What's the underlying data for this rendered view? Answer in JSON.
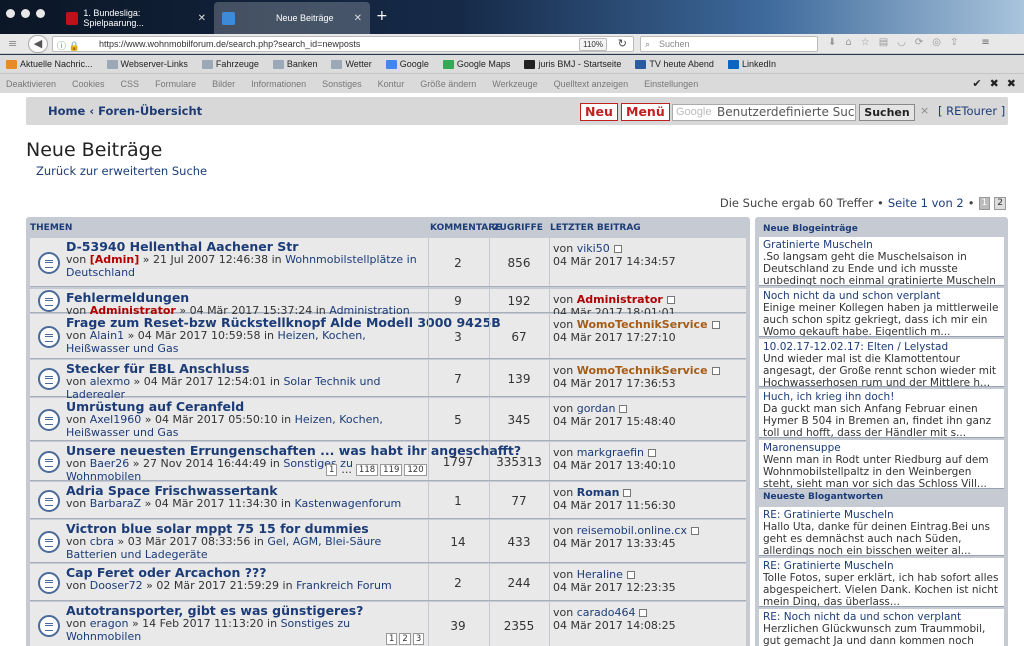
{
  "browser": {
    "tabs": [
      {
        "label": "1. Bundesliga: Spielpaarung...",
        "favicon_color": "#c0101a"
      },
      {
        "label": "Neue Beiträge",
        "favicon_color": "#3c8ad8"
      }
    ],
    "url": "https://www.wohnmobilforum.de/search.php?search_id=newposts",
    "zoom": "110%",
    "search_placeholder": "Suchen",
    "bookmarks": [
      "Aktuelle Nachric...",
      "Webserver-Links",
      "Fahrzeuge",
      "Banken",
      "Wetter",
      "Google",
      "Google Maps",
      "juris BMJ - Startseite",
      "TV heute Abend",
      "LinkedIn"
    ],
    "toolbar2": [
      "Deaktivieren",
      "Cookies",
      "CSS",
      "Formulare",
      "Bilder",
      "Informationen",
      "Sonstiges",
      "Kontur",
      "Größe ändern",
      "Werkzeuge",
      "Quelltext anzeigen",
      "Einstellungen"
    ]
  },
  "topbar": {
    "home": "Home",
    "sep": "‹",
    "forums": "Foren-Übersicht",
    "neu": "Neu",
    "menu": "Menü",
    "search_placeholder": "Benutzerdefinierte Such",
    "google": "Google",
    "search_btn": "Suchen",
    "clear": "×",
    "retour": "[ RETourer ]"
  },
  "page": {
    "title": "Neue Beiträge",
    "back": "Zurück zur erweiterten Suche"
  },
  "pagination": {
    "text": "Die Suche ergab 60 Treffer •",
    "page": "Seite 1 von 2",
    "sep": "•",
    "p1": "1",
    "p2": "2"
  },
  "forum": {
    "headers": {
      "topics": "THEMEN",
      "comments": "KOMMENTARE",
      "views": "ZUGRIFFE",
      "last": "LETZTER BEITRAG"
    },
    "rows": [
      {
        "title": "D-53940 Hellenthal Aachener Str",
        "von": "von",
        "author": "[Admin]",
        "admin": true,
        "date": "» 21 Jul 2007 12:46:38 in",
        "forum": "Wohnmobilstellplätze in Deutschland",
        "replies": "2",
        "views": "856",
        "last_user": "viki50",
        "last_date": "04 Mär 2017 14:34:57",
        "pages": []
      },
      {
        "title": "Fehlermeldungen",
        "von": "von",
        "author": "Administrator",
        "admin": true,
        "date": "» 04 Mär 2017 15:37:24 in",
        "forum": "Administration",
        "replies": "9",
        "views": "192",
        "last_user": "Administrator",
        "last_date": "04 Mär 2017 18:01:01",
        "pages": []
      },
      {
        "title": "Frage zum Reset-bzw Rückstellknopf Alde Modell 3000 9425B",
        "von": "von",
        "author": "Alain1",
        "admin": false,
        "date": "» 04 Mär 2017 10:59:58 in",
        "forum": "Heizen, Kochen, Heißwasser und Gas",
        "replies": "3",
        "views": "67",
        "last_user": "WomoTechnikService",
        "last_date": "04 Mär 2017 17:27:10",
        "pages": []
      },
      {
        "title": "Stecker für EBL Anschluss",
        "von": "von",
        "author": "alexmo",
        "admin": false,
        "date": "» 04 Mär 2017 12:54:01 in",
        "forum": "Solar Technik und Laderegler",
        "replies": "7",
        "views": "139",
        "last_user": "WomoTechnikService",
        "last_date": "04 Mär 2017 17:36:53",
        "pages": []
      },
      {
        "title": "Umrüstung auf Ceranfeld",
        "von": "von",
        "author": "Axel1960",
        "admin": false,
        "date": "» 04 Mär 2017 05:50:10 in",
        "forum": "Heizen, Kochen, Heißwasser und Gas",
        "replies": "5",
        "views": "345",
        "last_user": "gordan",
        "last_date": "04 Mär 2017 15:48:40",
        "pages": []
      },
      {
        "title": "Unsere neuesten Errungenschaften ... was habt ihr angeschafft?",
        "von": "von",
        "author": "Baer26",
        "admin": false,
        "date": "» 27 Nov 2014 16:44:49 in",
        "forum": "Sonstiges zu Wohnmobilen",
        "replies": "1797",
        "views": "335313",
        "last_user": "markgraefin",
        "last_date": "04 Mär 2017 13:40:10",
        "pages": [
          "1",
          "...",
          "118",
          "119",
          "120"
        ]
      },
      {
        "title": "Adria Space Frischwassertank",
        "von": "von",
        "author": "BarbaraZ",
        "admin": false,
        "date": "» 04 Mär 2017 11:34:30 in",
        "forum": "Kastenwagenforum",
        "replies": "1",
        "views": "77",
        "last_user": "Roman",
        "last_date": "04 Mär 2017 11:56:30",
        "pages": []
      },
      {
        "title": "Victron blue solar mppt 75 15 for dummies",
        "von": "von",
        "author": "cbra",
        "admin": false,
        "date": "» 03 Mär 2017 08:33:56 in",
        "forum": "Gel, AGM, Blei-Säure Batterien und Ladegeräte",
        "replies": "14",
        "views": "433",
        "last_user": "reisemobil.online.cx",
        "last_date": "04 Mär 2017 13:33:45",
        "pages": []
      },
      {
        "title": "Cap Feret oder Arcachon ???",
        "von": "von",
        "author": "Dooser72",
        "admin": false,
        "date": "» 02 Mär 2017 21:59:29 in",
        "forum": "Frankreich Forum",
        "replies": "2",
        "views": "244",
        "last_user": "Heraline",
        "last_date": "04 Mär 2017 12:23:35",
        "pages": []
      },
      {
        "title": "Autotransporter, gibt es was günstigeres?",
        "von": "von",
        "author": "eragon",
        "admin": false,
        "date": "» 14 Feb 2017 11:13:20 in",
        "forum": "Sonstiges zu Wohnmobilen",
        "replies": "39",
        "views": "2355",
        "last_user": "carado464",
        "last_date": "04 Mär 2017 14:08:25",
        "pages": [
          "1",
          "2",
          "3"
        ]
      }
    ]
  },
  "sidebar": {
    "blog_head": "Neue Blogeinträge",
    "blog": [
      {
        "title": "Gratinierte Muscheln",
        "text": ".So langsam geht die Muschelsaison in Deutschland zu Ende und ich musste unbedingt noch einmal gratinierte Muscheln mach..."
      },
      {
        "title": "Noch nicht da und schon verplant",
        "text": "Einige meiner Kollegen haben ja mittlerweile auch schon spitz gekriegt, dass ich mir ein Womo gekauft habe. Eigentlich m..."
      },
      {
        "title": "10.02.17-12.02.17: Elten / Lelystad",
        "text": "Und wieder mal ist die Klamottentour angesagt, der Große rennt schon wieder mit Hochwasserhosen rum und der Mittlere h..."
      },
      {
        "title": "Huch, ich krieg ihn doch!",
        "text": "Da guckt man sich Anfang Februar einen Hymer B 504 in Bremen an, findet ihn ganz toll und hofft, dass der Händler mit s..."
      },
      {
        "title": "Maronensuppe",
        "text": "Wenn man in Rodt unter Riedburg auf dem Wohnmobilstellpaltz in den Weinbergen steht, sieht man vor sich das Schloss Vill..."
      }
    ],
    "answers_head": "Neueste Blogantworten",
    "answers": [
      {
        "title": "RE: Gratinierte Muscheln",
        "text": "Hallo Uta, danke für deinen Eintrag.Bei uns geht es demnächst auch nach Süden, allerdings noch ein bisschen weiter al..."
      },
      {
        "title": "RE: Gratinierte Muscheln",
        "text": "Tolle Fotos, super erklärt, ich hab sofort alles abgespeichert. Vielen Dank. Kochen ist nicht mein Ding, das überlass..."
      },
      {
        "title": "RE: Noch nicht da und schon verplant",
        "text": "Herzlichen Glückwunsch zum Traummobil, gut gemacht Ja und dann kommen noch Freunde und"
      }
    ]
  }
}
